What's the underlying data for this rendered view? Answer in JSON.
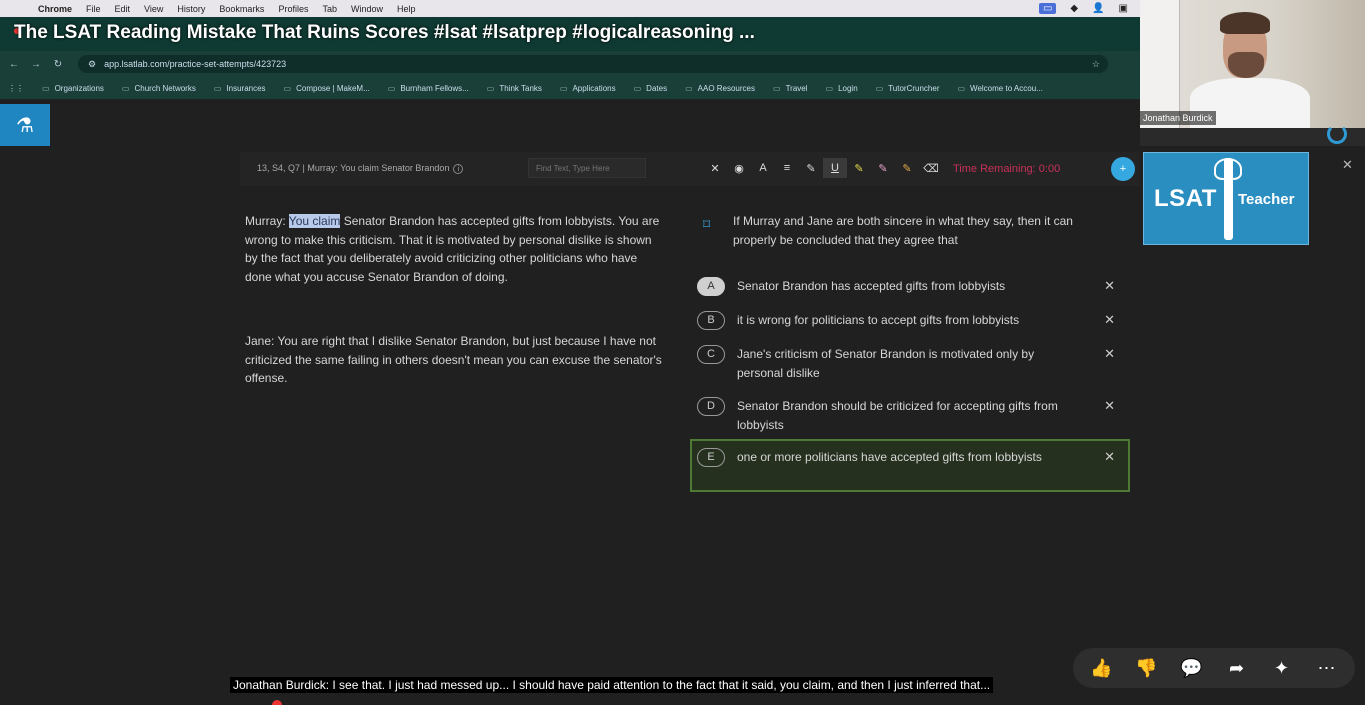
{
  "menubar": {
    "items": [
      "Chrome",
      "File",
      "Edit",
      "View",
      "History",
      "Bookmarks",
      "Profiles",
      "Tab",
      "Window",
      "Help"
    ]
  },
  "video": {
    "title": "The LSAT Reading Mistake That Ruins Scores #lsat  #lsatprep  #logicalreasoning  ..."
  },
  "browser": {
    "url": "app.lsatlab.com/practice-set-attempts/423723",
    "bookmarks": [
      "Organizations",
      "Church Networks",
      "Insurances",
      "Compose | MakeM...",
      "Burnham Fellows...",
      "Think Tanks",
      "Applications",
      "Dates",
      "AAO Resources",
      "Travel",
      "Login",
      "TutorCruncher",
      "Welcome to Accou..."
    ]
  },
  "toolbar": {
    "breadcrumb": "13, S4, Q7 | Murray: You claim Senator Brandon",
    "find_placeholder": "Find Text, Type Here",
    "timer": "Time Remaining: 0:00"
  },
  "passage": {
    "p1_speaker": "Murray:",
    "p1_highlight": "You claim",
    "p1_rest": " Senator Brandon has accepted gifts from lobbyists. You are wrong to make this criticism. That it is motivated by personal dislike is shown by the fact that you deliberately avoid criticizing other politicians who have done what you accuse Senator Brandon of doing.",
    "p2_speaker": "Jane:",
    "p2_rest": " You are right that I dislike Senator Brandon, but just because I have not criticized the same failing in others doesn't mean you can excuse the senator's offense."
  },
  "question": {
    "stem": "If Murray and Jane are both sincere in what they say, then it can properly be concluded that they agree that",
    "choices": [
      {
        "letter": "A",
        "text": "Senator Brandon has accepted gifts from lobbyists"
      },
      {
        "letter": "B",
        "text": "it is wrong for politicians to accept gifts from lobbyists"
      },
      {
        "letter": "C",
        "text": "Jane's criticism of Senator Brandon is motivated only by personal dislike"
      },
      {
        "letter": "D",
        "text": "Senator Brandon should be criticized for accepting gifts from lobbyists"
      },
      {
        "letter": "E",
        "text": "one or more politicians have accepted gifts from lobbyists"
      }
    ]
  },
  "webcam": {
    "name": "Jonathan Burdick"
  },
  "logo": {
    "left": "LSAT",
    "right": "Teacher"
  },
  "caption": "Jonathan Burdick: I see that. I just had messed up... I should have paid attention to the fact that it said, you claim, and then I just inferred that...",
  "colors": {
    "accent": "#35a8e0",
    "timer": "#c8305a",
    "selected_border": "#4f7a36"
  }
}
